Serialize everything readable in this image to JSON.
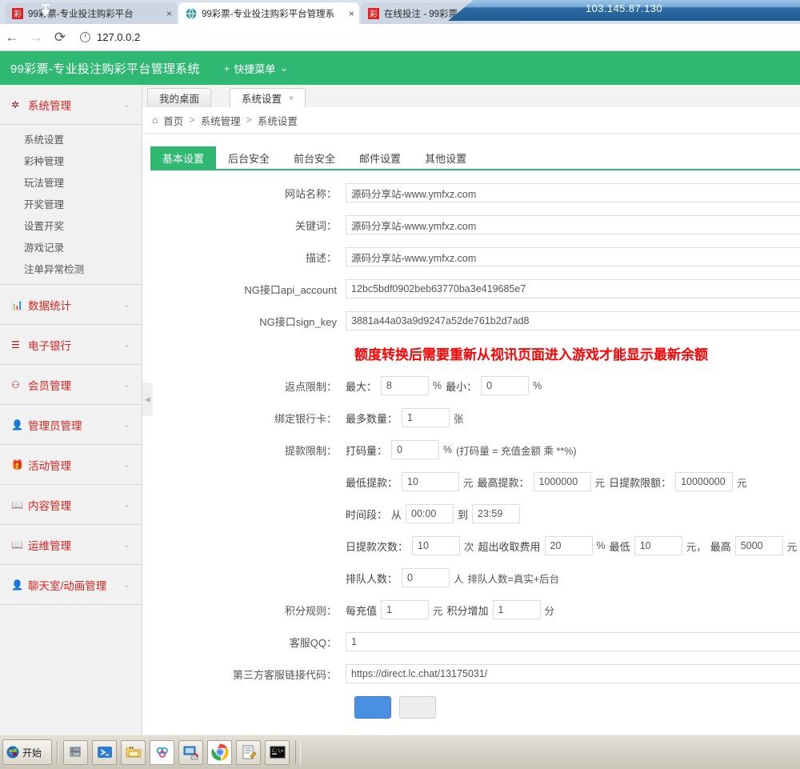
{
  "remote": {
    "ip": "103.145.87.130",
    "pin_icon": "pin-icon"
  },
  "browser": {
    "tabs": [
      {
        "title": "99彩票-专业投注购彩平台",
        "favicon": "lottery-favicon",
        "active": false,
        "close": "×"
      },
      {
        "title": "99彩票-专业投注购彩平台管理系",
        "favicon": "globe-favicon",
        "active": true,
        "close": "×"
      },
      {
        "title": "在线投注 - 99彩票-专业投注购彩",
        "favicon": "lottery-favicon",
        "active": false,
        "close": "×"
      }
    ],
    "new_tab": "+",
    "back_icon": "←",
    "forward_icon": "→",
    "reload_icon": "⟳",
    "url": "127.0.0.2"
  },
  "app_header": {
    "title": "99彩票-专业投注购彩平台管理系统",
    "quick_menu_label": "快捷菜单",
    "quick_menu_plus": "+",
    "quick_menu_caret": "⌄"
  },
  "sidebar": {
    "groups": [
      {
        "label": "系统管理",
        "icon": "gear-icon",
        "caret": "⌄",
        "expanded": true,
        "items": [
          "系统设置",
          "彩种管理",
          "玩法管理",
          "开奖管理",
          "设置开奖",
          "游戏记录",
          "注单异常检测"
        ]
      },
      {
        "label": "数据统计",
        "icon": "chart-icon",
        "caret": "⌄",
        "expanded": false,
        "items": []
      },
      {
        "label": "电子银行",
        "icon": "bank-icon",
        "caret": "⌄",
        "expanded": false,
        "items": []
      },
      {
        "label": "会员管理",
        "icon": "user-icon",
        "caret": "⌄",
        "expanded": false,
        "items": []
      },
      {
        "label": "管理员管理",
        "icon": "admin-icon",
        "caret": "⌄",
        "expanded": false,
        "items": []
      },
      {
        "label": "活动管理",
        "icon": "gift-icon",
        "caret": "⌄",
        "expanded": false,
        "items": []
      },
      {
        "label": "内容管理",
        "icon": "book-icon",
        "caret": "⌄",
        "expanded": false,
        "items": []
      },
      {
        "label": "运维管理",
        "icon": "book-icon",
        "caret": "⌄",
        "expanded": false,
        "items": []
      },
      {
        "label": "聊天室/动画管理",
        "icon": "admin-icon",
        "caret": "⌄",
        "expanded": false,
        "items": []
      }
    ],
    "collapse_arrow": "◀"
  },
  "content": {
    "tabs": [
      {
        "label": "我的桌面",
        "active": false
      },
      {
        "label": "系统设置",
        "active": true,
        "close": "×"
      }
    ],
    "breadcrumb": {
      "home_icon": "home-icon",
      "items": [
        "首页",
        "系统管理",
        "系统设置"
      ],
      "sep": ">"
    },
    "subtabs": [
      {
        "label": "基本设置",
        "active": true
      },
      {
        "label": "后台安全",
        "active": false
      },
      {
        "label": "前台安全",
        "active": false
      },
      {
        "label": "邮件设置",
        "active": false
      },
      {
        "label": "其他设置",
        "active": false
      }
    ]
  },
  "form": {
    "site_name": {
      "label": "网站名称：",
      "value": "源码分享站-www.ymfxz.com"
    },
    "keywords": {
      "label": "关键词：",
      "value": "源码分享站-www.ymfxz.com"
    },
    "description": {
      "label": "描述：",
      "value": "源码分享站-www.ymfxz.com"
    },
    "api_account": {
      "label": "NG接口api_account",
      "value": "12bc5bdf0902beb63770ba3e419685e7"
    },
    "sign_key": {
      "label": "NG接口sign_key",
      "value": "3881a44a03a9d9247a52de761b2d7ad8"
    },
    "warning": "额度转换后需要重新从视讯页面进入游戏才能显示最新余额",
    "rebate": {
      "label": "返点限制：",
      "max_label": "最大：",
      "max_value": "8",
      "max_unit": "%",
      "min_label": "最小：",
      "min_value": "0",
      "min_unit": "%"
    },
    "bankcard": {
      "label": "绑定银行卡：",
      "count_label": "最多数量：",
      "count_value": "1",
      "count_unit": "张"
    },
    "withdraw": {
      "label": "提款限制：",
      "bet_label": "打码量：",
      "bet_value": "0",
      "bet_unit": "%",
      "bet_note": "(打码量 = 充值金额 乘 **%)",
      "min_label": "最低提款：",
      "min_value": "10",
      "min_unit": "元",
      "max_label": "最高提款：",
      "max_value": "1000000",
      "max_unit": "元",
      "daily_label": "日提款限额：",
      "daily_value": "10000000",
      "daily_unit": "元",
      "time_label": "时间段：",
      "time_from_label": "从",
      "time_from": "00:00",
      "time_to_label": "到",
      "time_to": "23:59",
      "times_label": "日提款次数：",
      "times_value": "10",
      "times_unit": "次",
      "fee_label": "超出收取费用",
      "fee_value": "20",
      "fee_unit": "%",
      "fee_min_label": "最低",
      "fee_min_value": "10",
      "fee_min_unit": "元，",
      "fee_max_label": "最高",
      "fee_max_value": "5000",
      "fee_max_unit": "元",
      "queue_label": "排队人数：",
      "queue_value": "0",
      "queue_unit": "人",
      "queue_note": "排队人数=真实+后台"
    },
    "points": {
      "label": "积分规则：",
      "recharge_label": "每充值",
      "recharge_value": "1",
      "recharge_unit": "元",
      "add_label": "积分增加",
      "add_value": "1",
      "add_unit": "分"
    },
    "qq": {
      "label": "客服QQ：",
      "value": "1"
    },
    "chat_link": {
      "label": "第三方客服链接代码：",
      "value": "https://direct.lc.chat/13175031/"
    },
    "buttons": {
      "submit": "",
      "reset": ""
    }
  },
  "taskbar": {
    "start_label": "开始",
    "start_icon": "windows-icon",
    "icons": [
      "server-manager-icon",
      "powershell-icon",
      "explorer-icon",
      "cloud-icon",
      "remote-desktop-icon",
      "chrome-icon",
      "notepad-icon",
      "command-prompt-icon"
    ]
  },
  "colors": {
    "brand_green": "#2eb872",
    "sidebar_red": "#d9241f",
    "warning_red": "#ff0000",
    "primary_blue": "#4a90e2"
  }
}
